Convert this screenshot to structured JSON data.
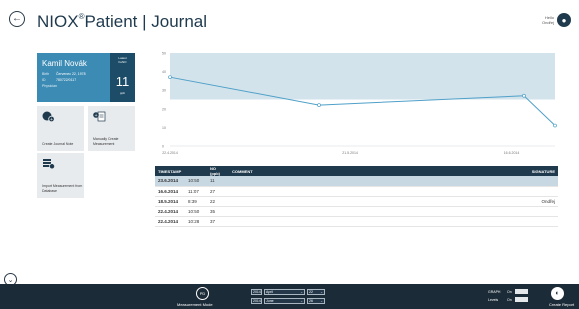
{
  "header": {
    "title_brand": "NIOX",
    "title_reg": "®",
    "title_rest": "Patient | Journal",
    "user_line1": "Hello",
    "user_line2": "Ondřej"
  },
  "patient": {
    "name": "Kamil Novák",
    "birth_label": "Birth",
    "birth_value": "Červenec 22, 1978",
    "id_label": "ID",
    "id_value": "780722/0117",
    "physician_label": "Physician",
    "latest_label_1": "Latest",
    "latest_label_2": "FeNO",
    "latest_value": "11",
    "latest_unit": "ppb"
  },
  "tiles": {
    "create_journal_note": "Create Journal Note",
    "manually_create": "Manually Create Measurement",
    "import_measurement": "Import Measurement from Database"
  },
  "chart_data": {
    "type": "line",
    "y_ticks": [
      "0",
      "10",
      "20",
      "30",
      "40",
      "50"
    ],
    "y_range": [
      0,
      50
    ],
    "x_labels": [
      "22.4.2014",
      "21.5.2014",
      "16.6.2014"
    ],
    "x_range_days": [
      0,
      62
    ],
    "band": [
      25,
      50
    ],
    "points": [
      {
        "x": "22.4.2014",
        "y": 37
      },
      {
        "x": "16.5.2014",
        "y": 22
      },
      {
        "x": "18.6.2014",
        "y": 27
      },
      {
        "x": "23.6.2014",
        "y": 11
      }
    ],
    "band_color": "#d3e3ec",
    "line_color": "#4fa0c8"
  },
  "table": {
    "headers": [
      "TIMESTAMP",
      "",
      "NO (ppb)",
      "COMMENT",
      "SIGNATURE"
    ],
    "rows": [
      {
        "date": "23.6.2014",
        "time": "10:50",
        "no": "11",
        "comment": "",
        "signature": ""
      },
      {
        "date": "16.6.2014",
        "time": "11:07",
        "no": "27",
        "comment": "",
        "signature": ""
      },
      {
        "date": "18.5.2014",
        "time": "8:39",
        "no": "22",
        "comment": "",
        "signature": "Ondřej"
      },
      {
        "date": "22.4.2014",
        "time": "10:50",
        "no": "35",
        "comment": "",
        "signature": ""
      },
      {
        "date": "22.4.2014",
        "time": "10:28",
        "no": "37",
        "comment": "",
        "signature": ""
      }
    ]
  },
  "bottombar": {
    "mode_icon_label": "PD",
    "mode_label": "Measurement Mode",
    "from_year": "2014",
    "from_month": "April",
    "from_day": "22",
    "to_year": "2014",
    "to_month": "June",
    "to_day": "26",
    "graph_label": "GRAPH",
    "graph_state": "On",
    "levels_label": "Levels",
    "levels_state": "On",
    "create_report_label": "Create Report"
  }
}
